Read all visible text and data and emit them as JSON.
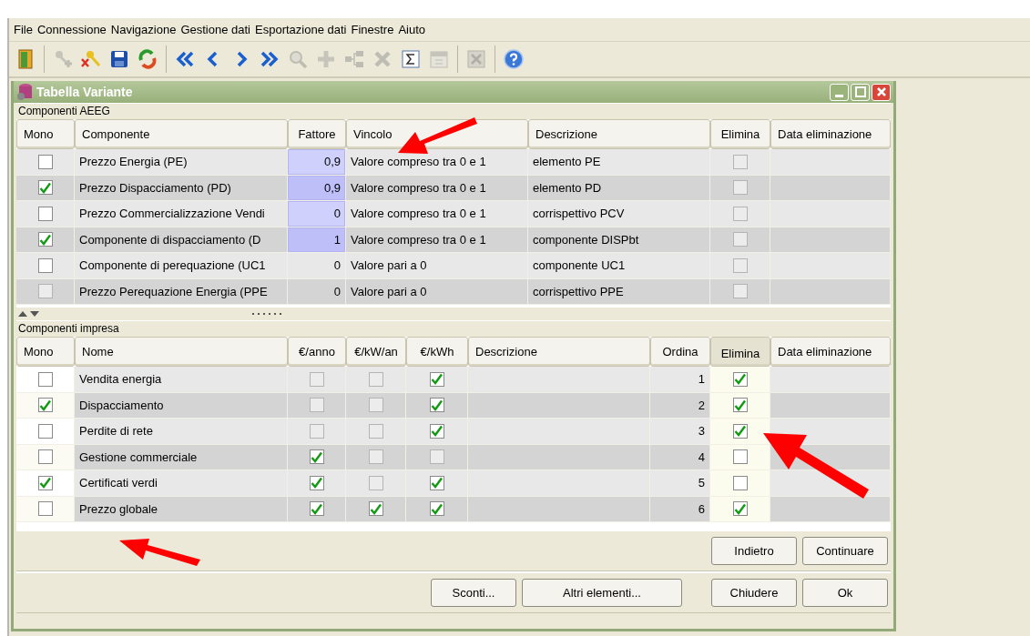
{
  "menu": [
    "File",
    "Connessione",
    "Navigazione",
    "Gestione dati",
    "Esportazione dati",
    "Finestre",
    "Aiuto"
  ],
  "toolbar": [
    [
      {
        "kind": "exit",
        "disabled": false
      }
    ],
    [
      {
        "kind": "key-add",
        "disabled": true
      },
      {
        "kind": "key-delete",
        "disabled": false
      },
      {
        "kind": "save",
        "disabled": false
      },
      {
        "kind": "refresh",
        "disabled": false
      }
    ],
    [
      {
        "kind": "first",
        "disabled": false
      },
      {
        "kind": "prev",
        "disabled": false
      },
      {
        "kind": "next",
        "disabled": false
      },
      {
        "kind": "last",
        "disabled": false
      },
      {
        "kind": "search",
        "disabled": true
      },
      {
        "kind": "add",
        "disabled": true
      },
      {
        "kind": "tree",
        "disabled": true
      },
      {
        "kind": "delete",
        "disabled": true
      },
      {
        "kind": "sum",
        "disabled": false
      },
      {
        "kind": "calendar",
        "disabled": true
      }
    ],
    [
      {
        "kind": "excel",
        "disabled": true
      }
    ],
    [
      {
        "kind": "help",
        "disabled": false
      }
    ]
  ],
  "window": {
    "title": "Tabella Variante"
  },
  "aeeg": {
    "title": "Componenti AEEG",
    "columns": [
      "Mono",
      "Componente",
      "Fattore",
      "Vincolo",
      "Descrizione",
      "Elimina",
      "Data eliminazione"
    ],
    "rows": [
      {
        "mono": false,
        "componente": "Prezzo Energia (PE)",
        "fattore": "0,9",
        "highlighted": true,
        "vincolo": "Valore compreso tra 0 e 1",
        "descrizione": "elemento PE",
        "elimina": false
      },
      {
        "mono": true,
        "componente": "Prezzo Dispacciamento (PD)",
        "fattore": "0,9",
        "highlighted": true,
        "vincolo": "Valore compreso tra 0 e 1",
        "descrizione": "elemento PD",
        "elimina": false
      },
      {
        "mono": false,
        "componente": "Prezzo Commercializzazione Vendi",
        "fattore": "0",
        "highlighted": true,
        "vincolo": "Valore compreso tra 0 e 1",
        "descrizione": "corrispettivo PCV",
        "elimina": false
      },
      {
        "mono": true,
        "componente": "Componente di dispacciamento (D",
        "fattore": "1",
        "highlighted": true,
        "vincolo": "Valore compreso tra 0 e 1",
        "descrizione": "componente DISPbt",
        "elimina": false
      },
      {
        "mono": false,
        "componente": "Componente di perequazione (UC1",
        "fattore": "0",
        "highlighted": false,
        "vincolo": "Valore pari a 0",
        "descrizione": "componente UC1",
        "elimina": false
      },
      {
        "mono": false,
        "componente": "Prezzo Perequazione Energia (PPE",
        "fattore": "0",
        "highlighted": false,
        "vincolo": "Valore pari a 0",
        "descrizione": "corrispettivo PPE",
        "elimina": false
      }
    ]
  },
  "impresa": {
    "title": "Componenti impresa",
    "columns": [
      {
        "label": "Mono",
        "selected": false
      },
      {
        "label": "Nome",
        "selected": false
      },
      {
        "label": "€/anno",
        "selected": false
      },
      {
        "label": "€/kW/an",
        "selected": false
      },
      {
        "label": "€/kWh",
        "selected": false
      },
      {
        "label": "Descrizione",
        "selected": false
      },
      {
        "label": "Ordina",
        "selected": false
      },
      {
        "label": "Elimina",
        "selected": true
      },
      {
        "label": "Data eliminazione",
        "selected": false
      }
    ],
    "rows": [
      {
        "mono": false,
        "nome": "Vendita energia",
        "anno": false,
        "kwan": false,
        "kwh": true,
        "ordina": "1",
        "elimina": true
      },
      {
        "mono": true,
        "nome": "Dispacciamento",
        "anno": false,
        "kwan": false,
        "kwh": true,
        "ordina": "2",
        "elimina": true
      },
      {
        "mono": false,
        "nome": "Perdite di rete",
        "anno": false,
        "kwan": false,
        "kwh": true,
        "ordina": "3",
        "elimina": true
      },
      {
        "mono": false,
        "nome": "Gestione commerciale",
        "anno": true,
        "kwan": false,
        "kwh": false,
        "ordina": "4",
        "elimina": false
      },
      {
        "mono": true,
        "nome": "Certificati verdi",
        "anno": true,
        "kwan": false,
        "kwh": true,
        "ordina": "5",
        "elimina": false
      },
      {
        "mono": false,
        "nome": "Prezzo globale",
        "anno": true,
        "kwan": true,
        "kwh": true,
        "ordina": "6",
        "elimina": true
      }
    ]
  },
  "nav_buttons": [
    "Indietro",
    "Continuare"
  ],
  "buttons": [
    "Sconti...",
    "Altri elementi...",
    "Chiudere",
    "Ok"
  ]
}
